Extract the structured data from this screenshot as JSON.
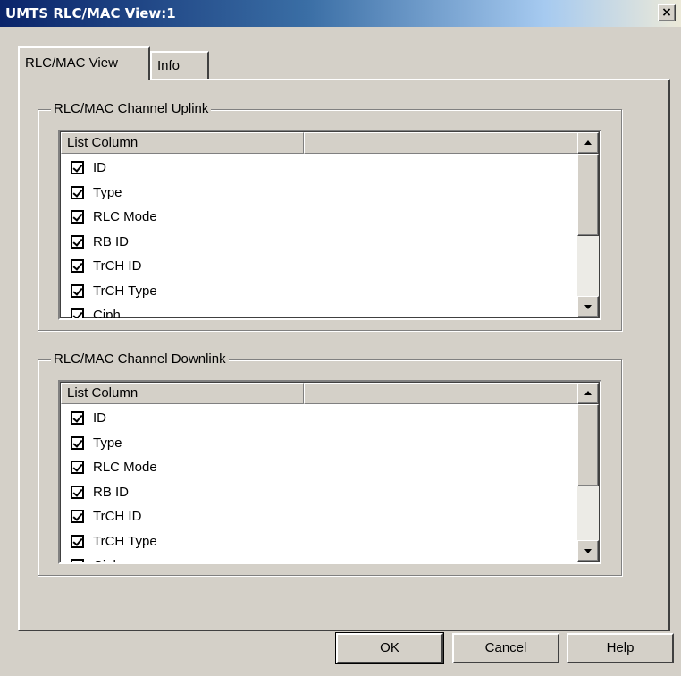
{
  "window": {
    "title": "UMTS RLC/MAC View:1",
    "close_glyph": "×"
  },
  "tabs": [
    {
      "label": "RLC/MAC View",
      "active": true
    },
    {
      "label": "Info",
      "active": false
    }
  ],
  "uplink": {
    "group_label": "RLC/MAC Channel Uplink",
    "columns": [
      "List Column",
      ""
    ],
    "items": [
      {
        "label": "ID",
        "checked": true
      },
      {
        "label": "Type",
        "checked": true
      },
      {
        "label": "RLC Mode",
        "checked": true
      },
      {
        "label": "RB ID",
        "checked": true
      },
      {
        "label": "TrCH ID",
        "checked": true
      },
      {
        "label": "TrCH Type",
        "checked": true
      },
      {
        "label": "Ciph",
        "checked": true
      }
    ]
  },
  "downlink": {
    "group_label": "RLC/MAC Channel Downlink",
    "columns": [
      "List Column",
      ""
    ],
    "items": [
      {
        "label": "ID",
        "checked": true
      },
      {
        "label": "Type",
        "checked": true
      },
      {
        "label": "RLC Mode",
        "checked": true
      },
      {
        "label": "RB ID",
        "checked": true
      },
      {
        "label": "TrCH ID",
        "checked": true
      },
      {
        "label": "TrCH Type",
        "checked": true
      },
      {
        "label": "Ciph",
        "checked": true
      }
    ]
  },
  "buttons": {
    "ok": "OK",
    "cancel": "Cancel",
    "help": "Help"
  },
  "icons": {
    "scroll_up": "up-arrow-icon",
    "scroll_down": "down-arrow-icon",
    "checkbox": "checkmark-icon"
  },
  "colors": {
    "dialog_face": "#d4d0c8",
    "title_active": "#0a246a",
    "list_background": "#ffffff"
  }
}
